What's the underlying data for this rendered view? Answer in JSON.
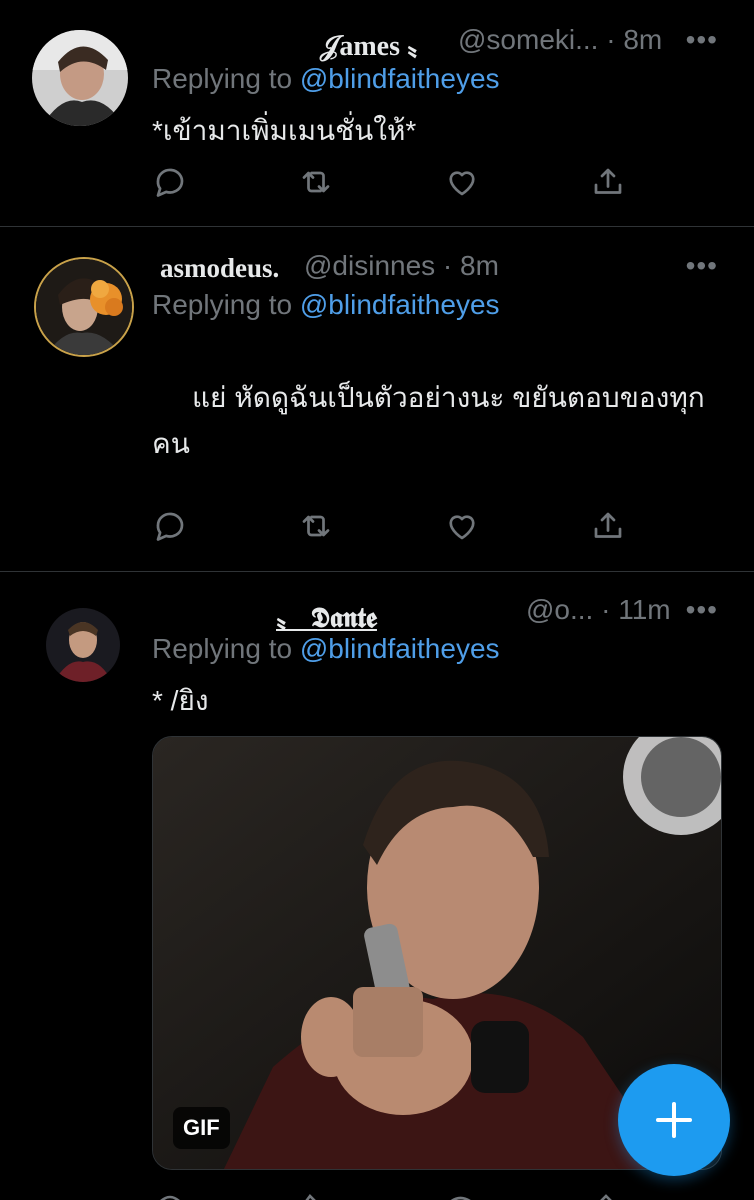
{
  "colors": {
    "background": "#000000",
    "text": "#e7e9ea",
    "muted": "#71767b",
    "mention": "#4f9ee8",
    "accent": "#1d9bf0",
    "divider": "#2f3336"
  },
  "tweets": [
    {
      "display_name": "𝒥ames 〟",
      "handle_time": "@someki... · 8m",
      "more_icon": "more-horizontal-icon",
      "replying_prefix": "Replying to",
      "replying_to": "@blindfaitheyes",
      "text": "*เข้ามาเพิ่มเมนชั่นให้*",
      "actions": [
        "reply-icon",
        "retweet-icon",
        "like-icon",
        "share-icon"
      ]
    },
    {
      "display_name": "asmodeus.",
      "handle_time": "@disinnes · 8m",
      "more_icon": "more-horizontal-icon",
      "replying_prefix": "Replying to",
      "replying_to": "@blindfaitheyes",
      "text_line1": "แย่ หัดดูฉันเป็นตัวอย่างนะ ขยันตอบของทุก",
      "text_line2": "คน",
      "actions": [
        "reply-icon",
        "retweet-icon",
        "like-icon",
        "share-icon"
      ]
    },
    {
      "display_name": "〟 𝕯𝖆𝖓𝖙𝖊",
      "handle_time": "@o... · 11m",
      "more_icon": "more-horizontal-icon",
      "replying_prefix": "Replying to",
      "replying_to": "@blindfaitheyes",
      "text": "* /ยิง",
      "media": {
        "type": "gif",
        "badge": "GIF"
      }
    }
  ],
  "compose_button": {
    "icon": "plus-icon"
  }
}
